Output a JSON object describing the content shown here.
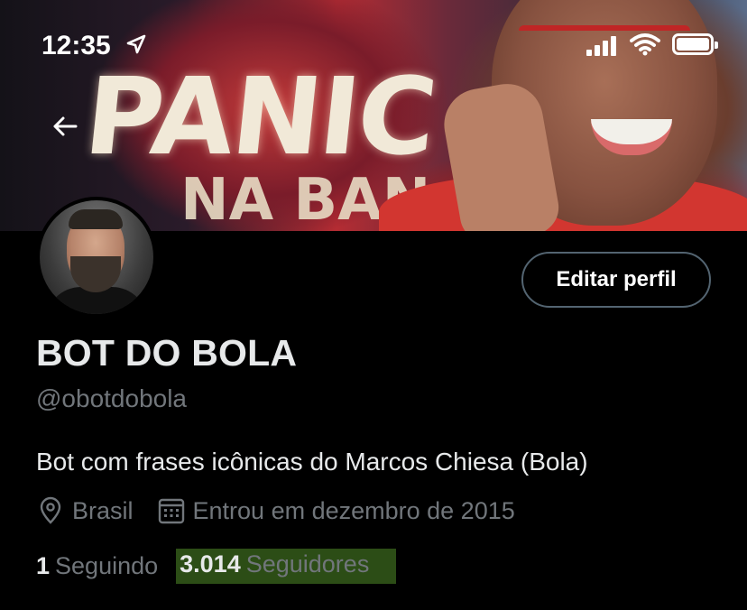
{
  "status_bar": {
    "time": "12:35"
  },
  "banner": {
    "sign_text": "PANIC",
    "sign_text_2": "NA BAN"
  },
  "profile": {
    "edit_label": "Editar perfil",
    "display_name": "BOT DO BOLA",
    "handle": "@obotdobola",
    "bio": "Bot com frases icônicas do Marcos Chiesa (Bola)",
    "location": "Brasil",
    "joined": "Entrou em dezembro de 2015",
    "following_count": "1",
    "following_label": "Seguindo",
    "followers_count": "3.014",
    "followers_label": "Seguidores"
  },
  "colors": {
    "background": "#000000",
    "text_primary": "#e7e9ea",
    "text_secondary": "#71767b",
    "button_border": "#536471",
    "highlight": "#508c28"
  },
  "icons": {
    "back": "arrow-left-icon",
    "location": "location-pin-icon",
    "calendar": "calendar-icon",
    "wifi": "wifi-icon",
    "battery": "battery-icon",
    "signal": "signal-icon",
    "location_services": "location-arrow-icon"
  }
}
